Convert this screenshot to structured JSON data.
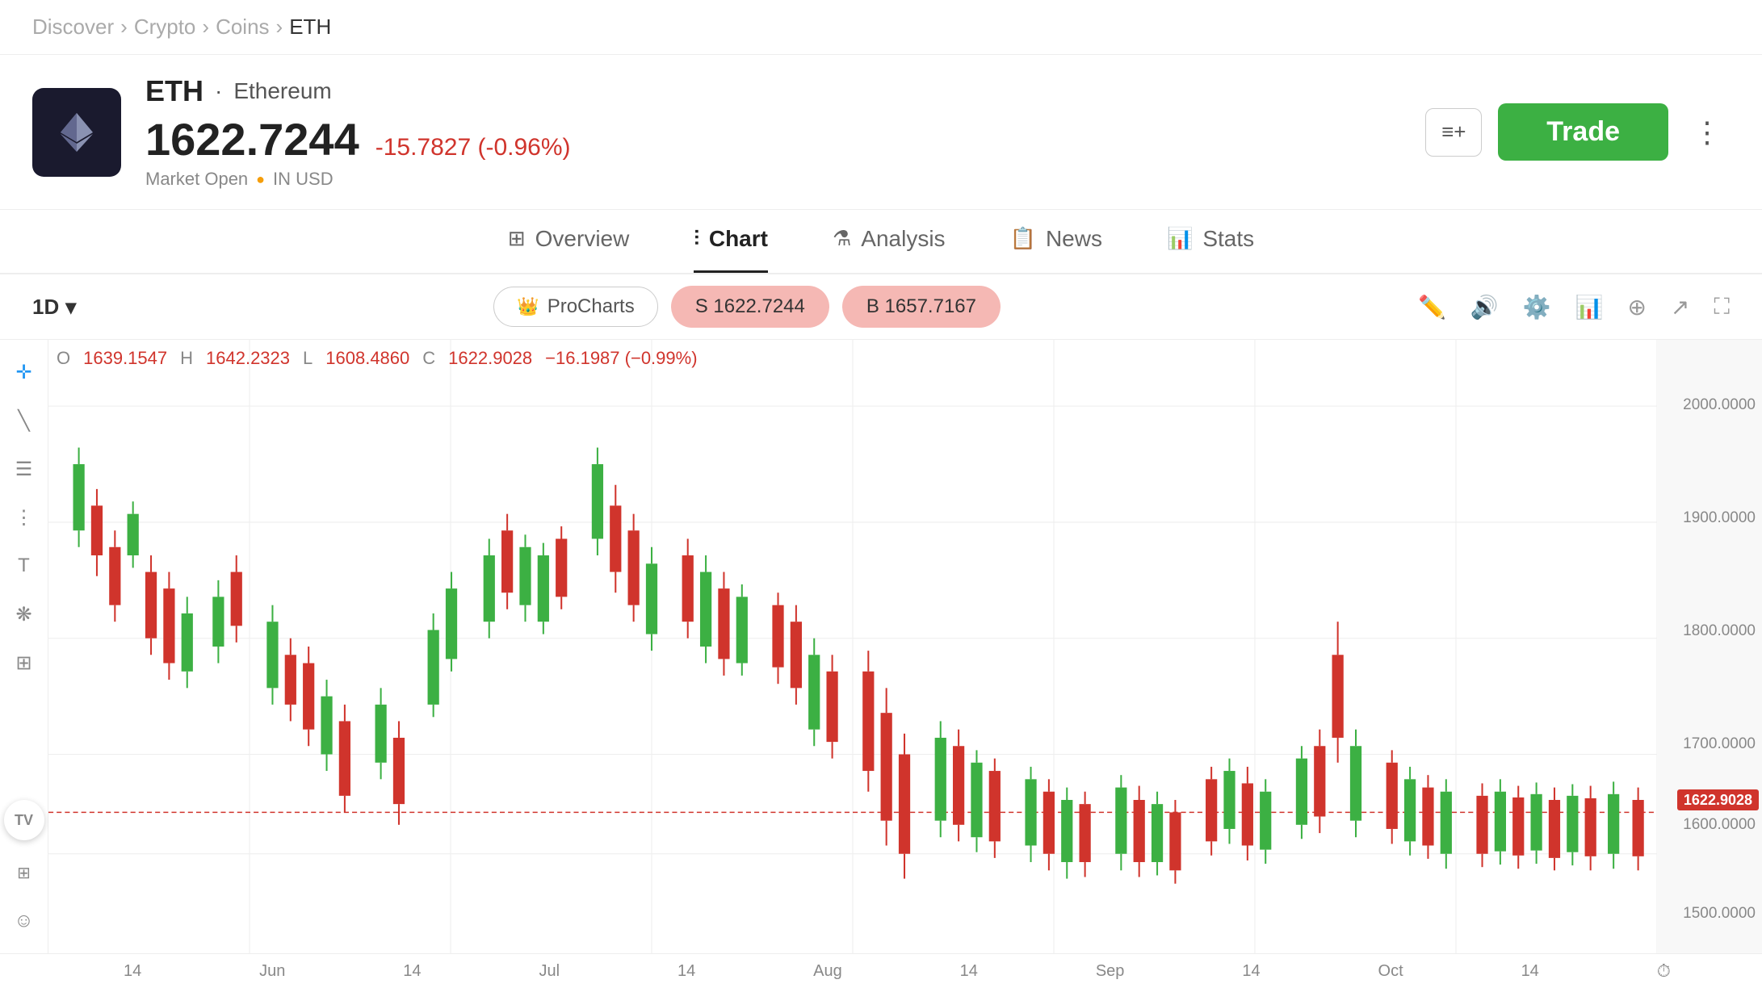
{
  "breadcrumb": {
    "items": [
      "Discover",
      "Crypto",
      "Coins",
      "ETH"
    ],
    "separators": [
      ">",
      ">",
      ">"
    ]
  },
  "header": {
    "ticker": "ETH",
    "separator": "·",
    "name": "Ethereum",
    "price": "1622.7244",
    "change": "-15.7827 (-0.96%)",
    "market_status": "Market Open",
    "currency": "IN USD",
    "watchlist_label": "≡+",
    "trade_label": "Trade",
    "more_label": "⋮"
  },
  "tabs": [
    {
      "id": "overview",
      "label": "Overview",
      "icon": "⊞",
      "active": false
    },
    {
      "id": "chart",
      "label": "Chart",
      "icon": "⫶",
      "active": true
    },
    {
      "id": "analysis",
      "label": "Analysis",
      "icon": "⚗",
      "active": false
    },
    {
      "id": "news",
      "label": "News",
      "icon": "📋",
      "active": false
    },
    {
      "id": "stats",
      "label": "Stats",
      "icon": "📊",
      "active": false
    }
  ],
  "toolbar": {
    "timeframe": "1D",
    "timeframe_arrow": "▾",
    "procharts_label": "ProCharts",
    "sell_label": "S 1622.7244",
    "buy_label": "B 1657.7167",
    "icons": [
      "✏",
      "🔊",
      "⚙",
      "📊",
      "+",
      "↗",
      "⛶"
    ]
  },
  "ohlc": {
    "o_label": "O",
    "o_value": "1639.1547",
    "h_label": "H",
    "h_value": "1642.2323",
    "l_label": "L",
    "l_value": "1608.4860",
    "c_label": "C",
    "c_value": "1622.9028",
    "change": "−16.1987 (−0.99%)"
  },
  "price_axis": {
    "labels": [
      "2000.0000",
      "1900.0000",
      "1800.0000",
      "1700.0000",
      "1600.0000",
      "1500.0000"
    ],
    "current": "1622.9028"
  },
  "xaxis": {
    "labels": [
      "14",
      "Jun",
      "14",
      "Jul",
      "14",
      "Aug",
      "14",
      "Sep",
      "14",
      "Oct",
      "14"
    ]
  },
  "watermark": "TV",
  "chart_tools": [
    "✛",
    "╲",
    "☰",
    "⌇",
    "T",
    "❋",
    "⊞"
  ]
}
